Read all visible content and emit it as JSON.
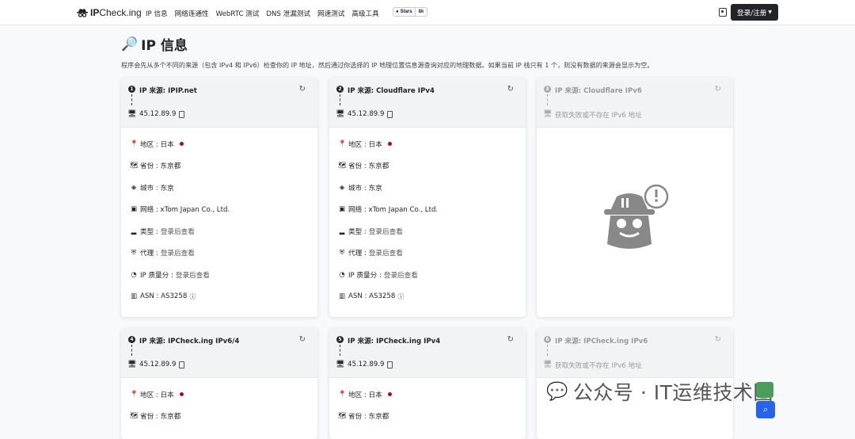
{
  "nav": {
    "brand_prefix": "IP",
    "brand_suffix": "Check.ing",
    "links": [
      "IP 信息",
      "网络连通性",
      "WebRTC 测试",
      "DNS 泄漏测试",
      "网速测试",
      "高级工具"
    ],
    "github_stars_label": "Stars",
    "github_stars_count": "8k",
    "login_label": "登录/注册"
  },
  "page": {
    "title": "IP 信息",
    "description": "程序会先从多个不同的来源（包含 IPv4 和 IPv6）检查你的 IP 地址，然后通过你选择的 IP 地理位置信息源查询对应的地理数据。如果当前 IP 栈只有 1 个，则没有数据的来源会显示为空。"
  },
  "cards": [
    {
      "num": "1",
      "source": "IP 来源: IPIP.net",
      "ip": "45.12.89.9",
      "enabled": true
    },
    {
      "num": "2",
      "source": "IP 来源: Cloudflare IPv4",
      "ip": "45.12.89.9",
      "enabled": true
    },
    {
      "num": "3",
      "source": "IP 来源: Cloudflare IPv6",
      "ip": "获取失败或不存在 IPv6 地址",
      "enabled": false
    },
    {
      "num": "4",
      "source": "IP 来源: IPCheck.ing IPv6/4",
      "ip": "45.12.89.9",
      "enabled": true
    },
    {
      "num": "5",
      "source": "IP 来源: IPCheck.ing IPv4",
      "ip": "45.12.89.9",
      "enabled": true
    },
    {
      "num": "6",
      "source": "IP 来源: IPCheck.ing IPv6",
      "ip": "获取失败或不存在 IPv6 地址",
      "enabled": false
    }
  ],
  "details": {
    "region": "地区 : 日本",
    "province": "省份 : 东京都",
    "city": "城市 : 东京",
    "network": "网络 : xTom Japan Co., Ltd.",
    "type_label": "类型 : ",
    "type_value": "登录后查看",
    "proxy_label": "代理 : ",
    "proxy_value": "登录后查看",
    "quality_label": "IP 质量分 : ",
    "quality_value": "登录后查看",
    "asn": "ASN : AS3258"
  },
  "watermark": "公众号 · IT运维技术圈",
  "colors": {
    "japan_dot": "#bc002d",
    "login_bg": "#212529",
    "search_fab": "#2563eb"
  }
}
